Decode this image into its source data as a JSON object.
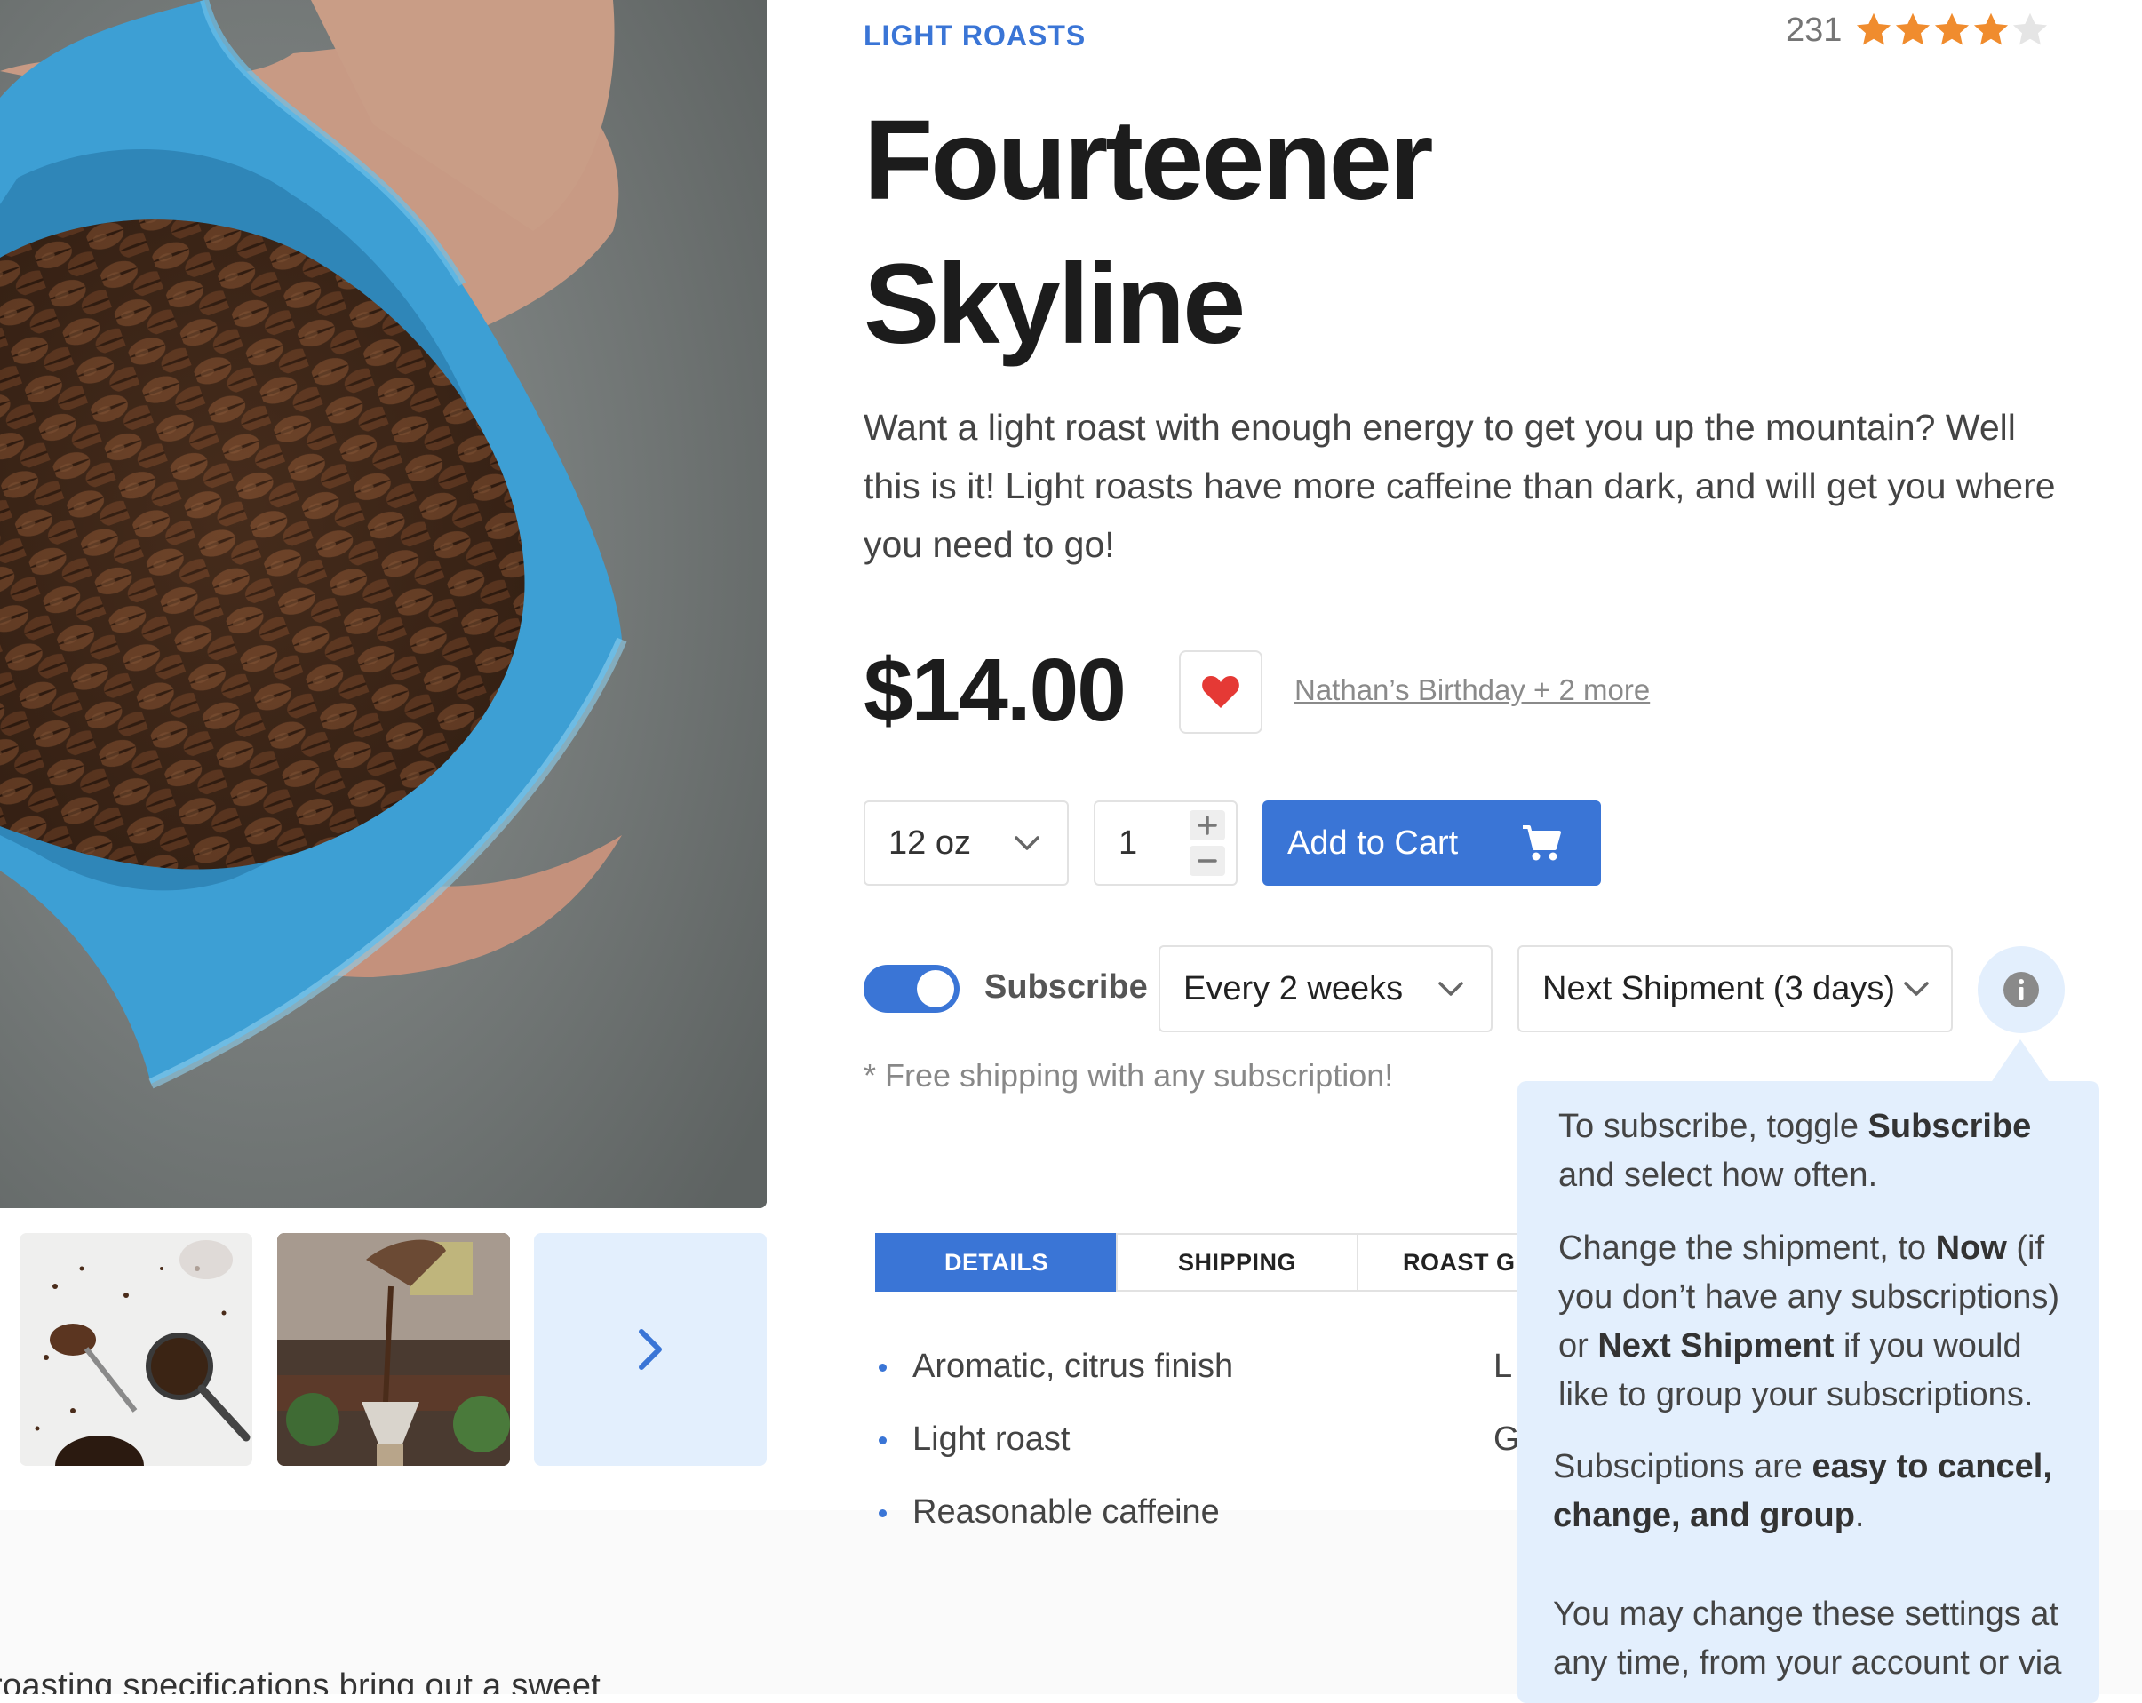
{
  "product": {
    "category": "LIGHT ROASTS",
    "rating_count": "231",
    "rating": 4,
    "rating_max": 5,
    "title": "Fourteener Skyline",
    "description": "Want a light roast with enough energy to get you up the mountain? Well this is it! Light roasts have more caffeine than dark, and will get you where you need to go!",
    "price": "$14.00",
    "spec_text": "roasting specifications bring out a sweet"
  },
  "wishlist": {
    "link_text": "Nathan’s Birthday + 2 more"
  },
  "purchase": {
    "size_value": "12 oz",
    "quantity_value": "1",
    "add_to_cart_label": "Add to Cart"
  },
  "subscription": {
    "toggle_on": true,
    "label": "Subscribe",
    "frequency_value": "Every 2 weeks",
    "shipment_value": "Next Shipment (3 days)",
    "note": "* Free shipping with any subscription!"
  },
  "tabs": [
    {
      "label": "DETAILS",
      "active": true
    },
    {
      "label": "SHIPPING",
      "active": false
    },
    {
      "label": "ROAST GU",
      "active": false
    }
  ],
  "details": {
    "left": [
      "Aromatic, citrus finish",
      "Light roast",
      "Reasonable caffeine"
    ],
    "right": [
      "L",
      "G"
    ]
  },
  "tooltip": {
    "p1_a": "To subscribe, toggle ",
    "p1_b": "Subscribe",
    "p1_c": " and select how often.",
    "p2_a": "Change the shipment, to ",
    "p2_b": "Now",
    "p2_c": " (if you don’t have any subscriptions) or ",
    "p2_d": "Next Shipment",
    "p2_e": " if you would like to group your subscriptions.",
    "p3_a": "Subsciptions are ",
    "p3_b": "easy to cancel, change, and group",
    "p3_c": ".",
    "p4": "You may change these settings at any time, from your account or via"
  },
  "colors": {
    "accent": "#3a75d6",
    "tooltip_bg": "#e3effd",
    "star": "#f08c2e",
    "star_empty": "#e5e5e5",
    "heart": "#e53935",
    "bag_blue": "#3d9fd4"
  },
  "icons": {
    "rating": "star-icon",
    "favorite": "heart-icon",
    "size_dropdown": "chevron-down-icon",
    "increment": "plus-icon",
    "decrement": "minus-icon",
    "cart": "shopping-cart-icon",
    "info": "info-icon",
    "next_image": "chevron-right-icon"
  }
}
